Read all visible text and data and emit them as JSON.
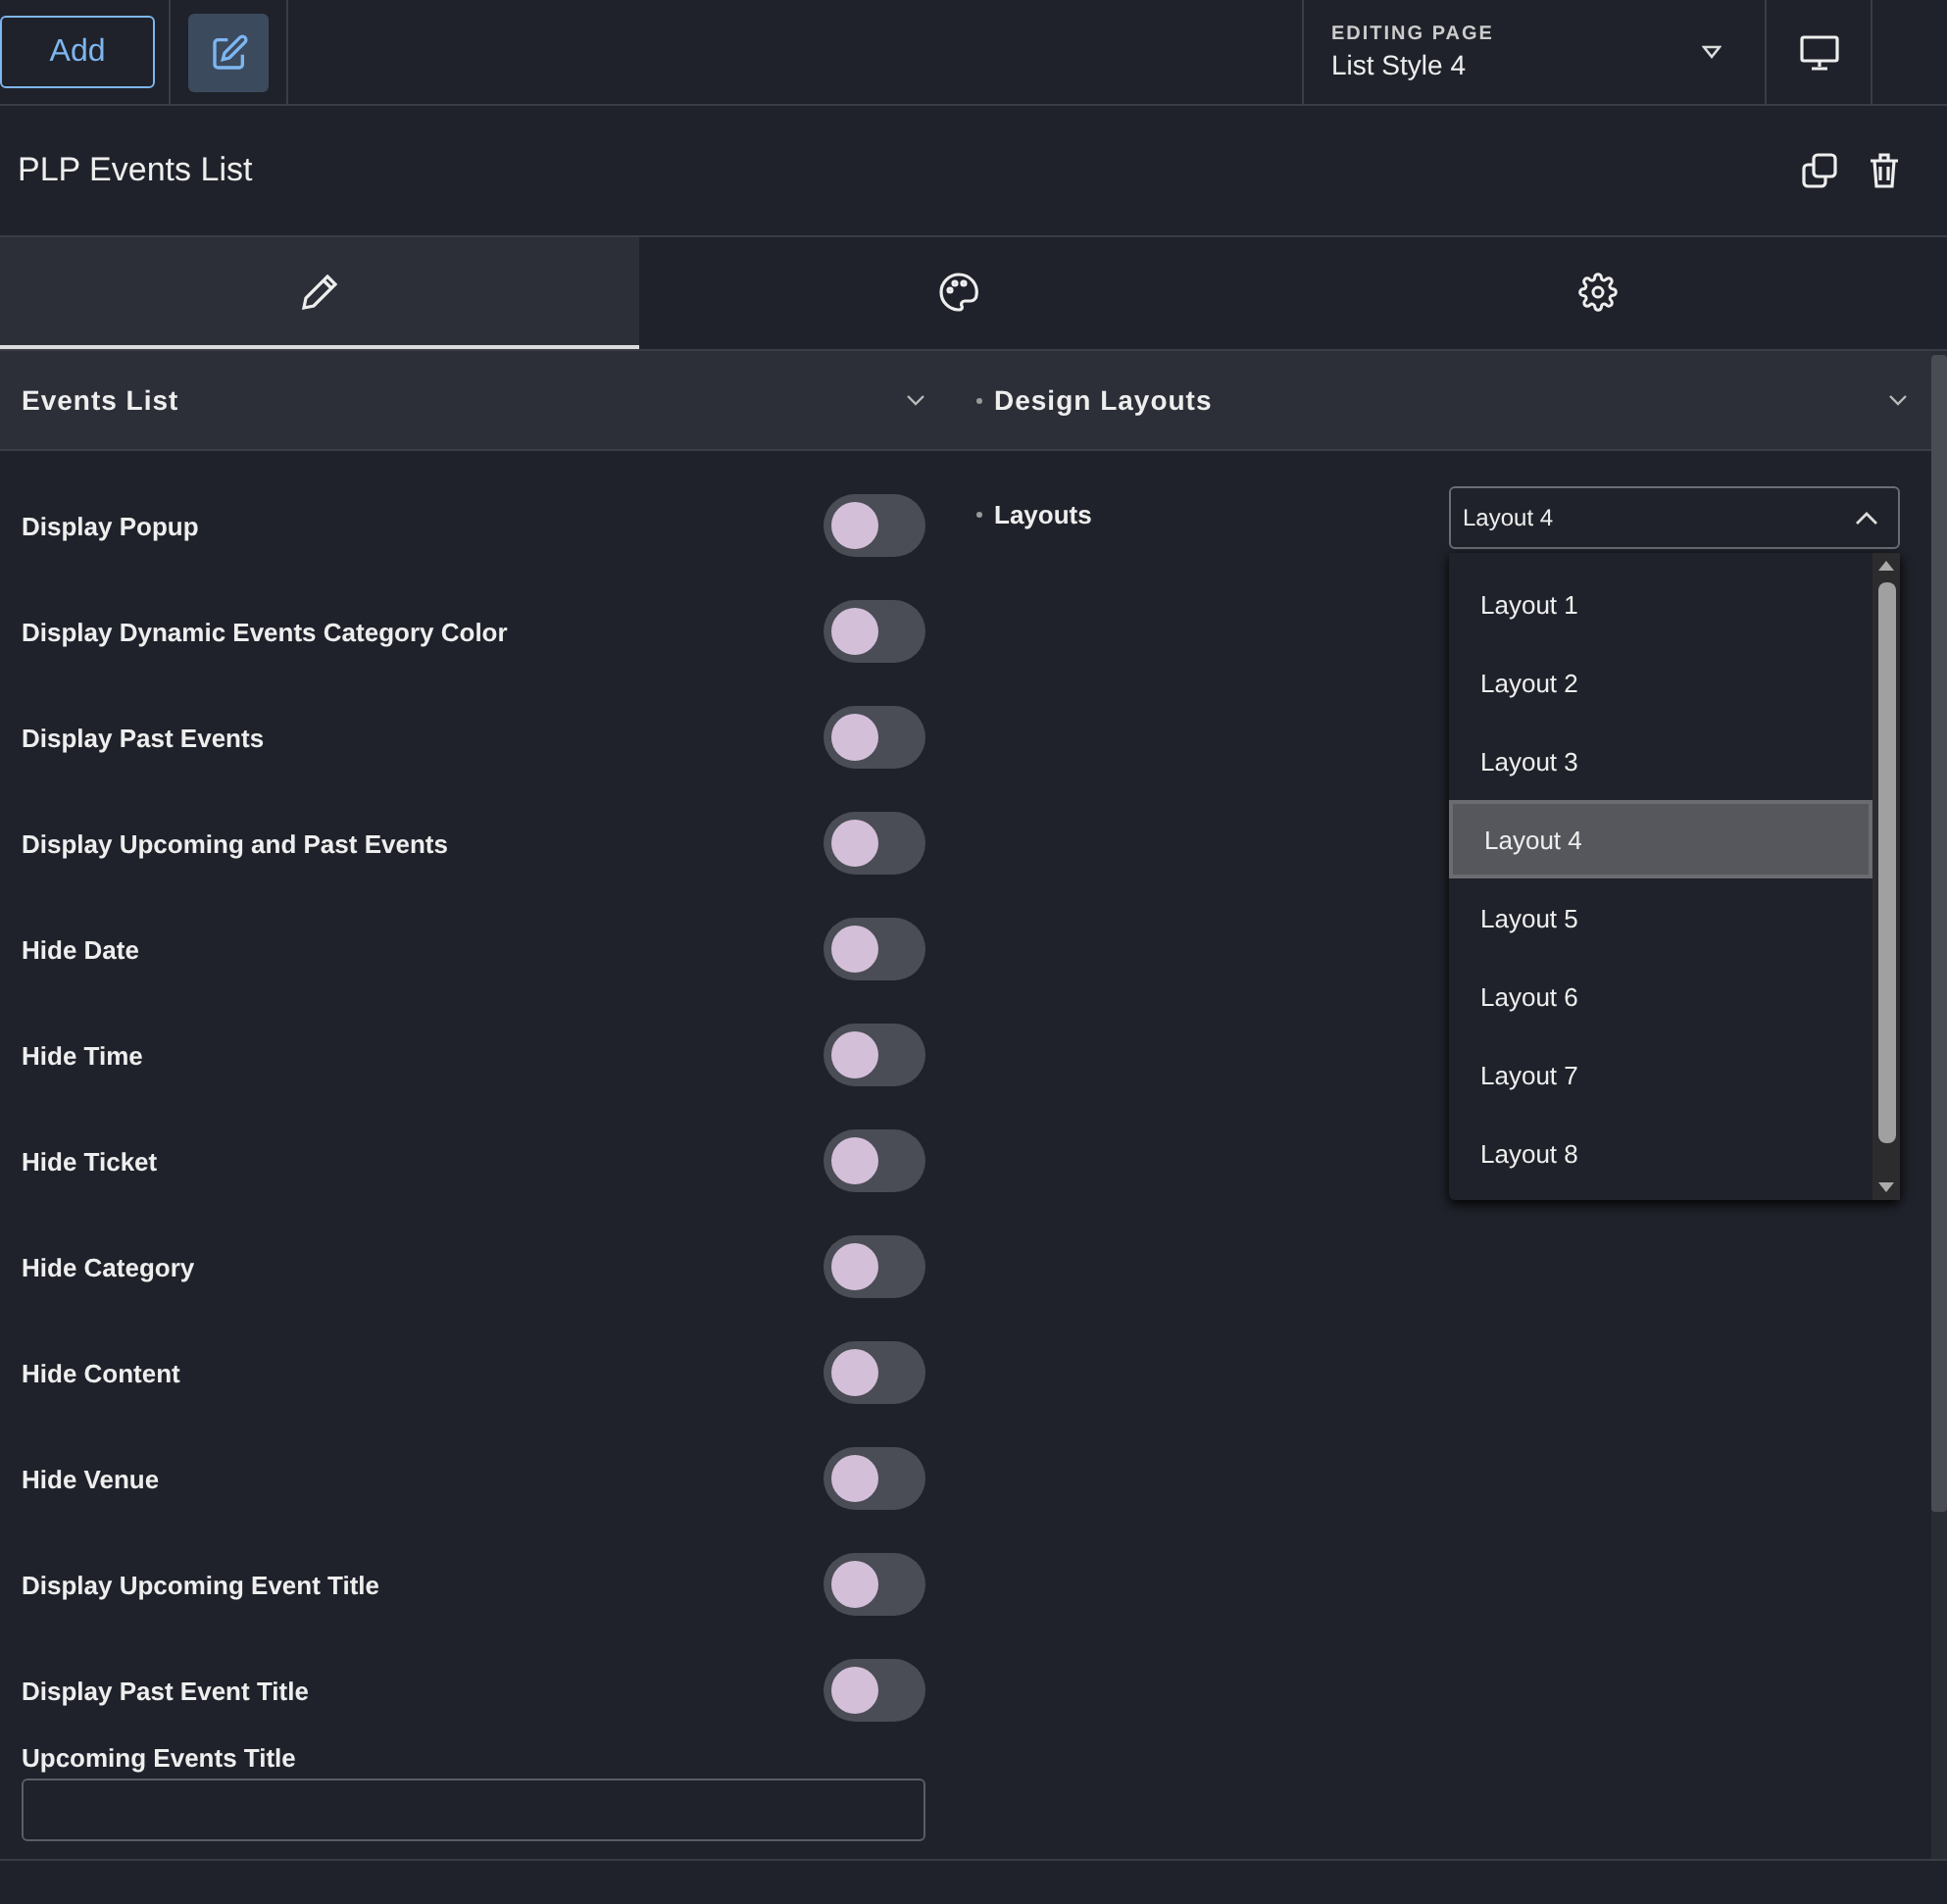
{
  "topbar": {
    "add_button": "Add",
    "editing_label": "EDITING PAGE",
    "editing_page": "List Style 4"
  },
  "panel": {
    "title": "PLP Events List"
  },
  "tabs": [
    {
      "kind": "edit",
      "selected": true
    },
    {
      "kind": "style",
      "selected": false
    },
    {
      "kind": "settings",
      "selected": false
    }
  ],
  "left_section": {
    "title": "Events List",
    "expanded": true,
    "toggles": [
      {
        "label": "Display Popup",
        "on": false
      },
      {
        "label": "Display Dynamic Events Category Color",
        "on": false
      },
      {
        "label": "Display Past Events",
        "on": false
      },
      {
        "label": "Display Upcoming and Past Events",
        "on": false
      },
      {
        "label": "Hide Date",
        "on": false
      },
      {
        "label": "Hide Time",
        "on": false
      },
      {
        "label": "Hide Ticket",
        "on": false
      },
      {
        "label": "Hide Category",
        "on": false
      },
      {
        "label": "Hide Content",
        "on": false
      },
      {
        "label": "Hide Venue",
        "on": false
      },
      {
        "label": "Display Upcoming Event Title",
        "on": false
      },
      {
        "label": "Display Past Event Title",
        "on": false
      }
    ],
    "text_field": {
      "label": "Upcoming Events Title"
    }
  },
  "right_section": {
    "title": "Design Layouts",
    "expanded": true,
    "field_label": "Layouts",
    "value": "Layout 4",
    "open": true,
    "options": [
      {
        "label": "Layout 1",
        "selected": false
      },
      {
        "label": "Layout 2",
        "selected": false
      },
      {
        "label": "Layout 3",
        "selected": false
      },
      {
        "label": "Layout 4",
        "selected": true
      },
      {
        "label": "Layout 5",
        "selected": false
      },
      {
        "label": "Layout 6",
        "selected": false
      },
      {
        "label": "Layout 7",
        "selected": false
      },
      {
        "label": "Layout 8",
        "selected": false
      }
    ]
  }
}
